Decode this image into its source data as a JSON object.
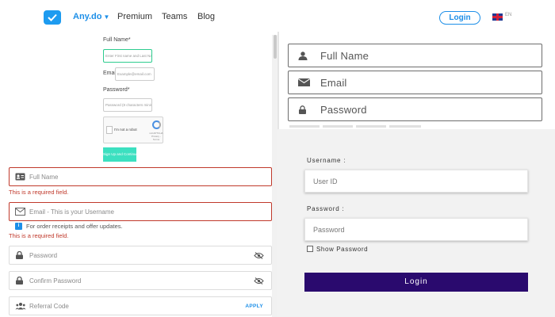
{
  "nav": {
    "brand": "Any.do",
    "links": [
      "Premium",
      "Teams",
      "Blog"
    ],
    "login": "Login",
    "lang": "EN"
  },
  "mini_form": {
    "full_name_label": "Full Name*",
    "full_name_placeholder": "Enter First name and Last Name",
    "email_label": "Email*",
    "email_placeholder": "Example@email.com",
    "password_label": "Password*",
    "password_placeholder": "Password (8 characters minimum)",
    "captcha_text": "I'm not a robot",
    "captcha_sub": "reCAPTCHA Privacy - Terms",
    "cta": "Sign Up and Continue"
  },
  "signup_form": {
    "full_name_placeholder": "Full Name",
    "email_placeholder": "Email - This is your Username",
    "required_error": "This is a required field.",
    "info_text": "For order receipts and offer updates.",
    "password_placeholder": "Password",
    "confirm_placeholder": "Confirm Password",
    "referral_placeholder": "Referral Code",
    "apply": "APPLY"
  },
  "icon_form": {
    "full_name": "Full Name",
    "email": "Email",
    "password": "Password"
  },
  "login_form": {
    "username_label": "Username :",
    "username_placeholder": "User ID",
    "password_label": "Password :",
    "password_placeholder": "Password",
    "show_password": "Show Password",
    "login_button": "Login"
  },
  "colors": {
    "brand_blue": "#1d8fe8",
    "error_red": "#c0392b",
    "login_button_bg": "#2a0a6e",
    "cta_green": "#3ce0c0"
  }
}
